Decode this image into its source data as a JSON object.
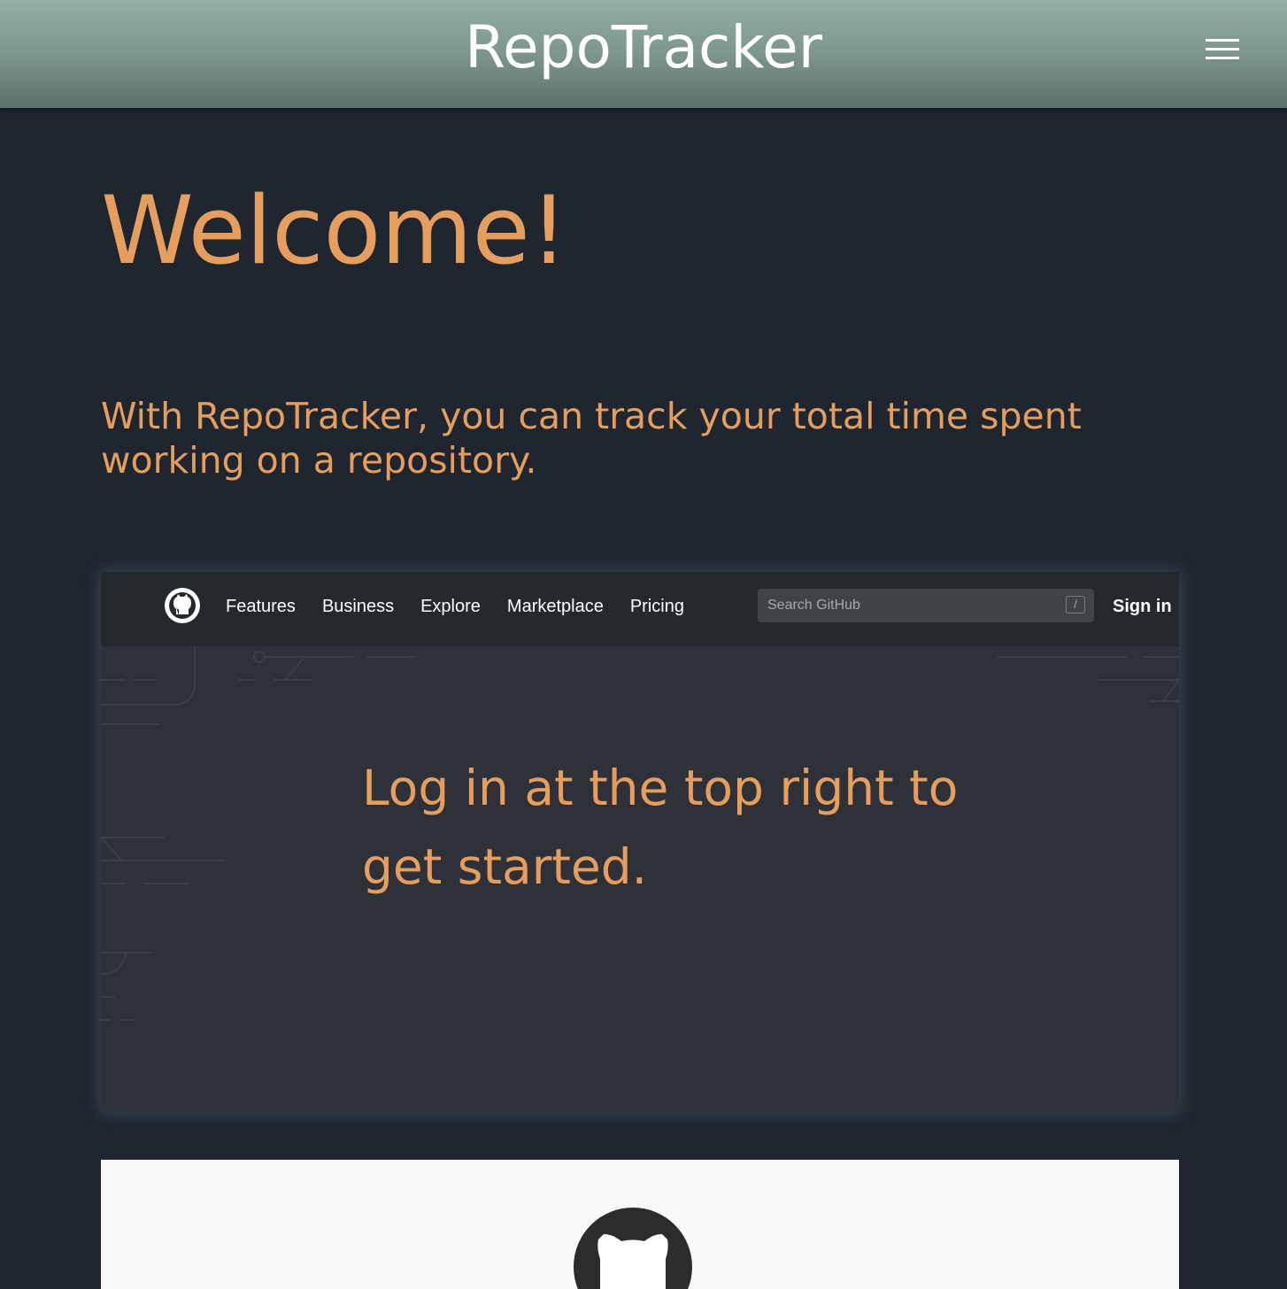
{
  "header": {
    "brand": "RepoTracker",
    "menu_icon": "hamburger-menu-icon"
  },
  "main": {
    "heading": "Welcome!",
    "intro": "With RepoTracker, you can track your total time spent working on a repository.",
    "login_message": "Log in at the top right to get started."
  },
  "screenshot": {
    "logo_icon": "github-logo-icon",
    "nav_links": [
      "Features",
      "Business",
      "Explore",
      "Marketplace",
      "Pricing"
    ],
    "search_placeholder": "Search GitHub",
    "search_shortcut": "/",
    "sign_in": "Sign in"
  },
  "card": {
    "icon": "octocat-icon"
  },
  "colors": {
    "accent": "#e59e5e",
    "background": "#1f2630",
    "header_top": "#93aea7",
    "header_bottom": "#5e706c"
  }
}
